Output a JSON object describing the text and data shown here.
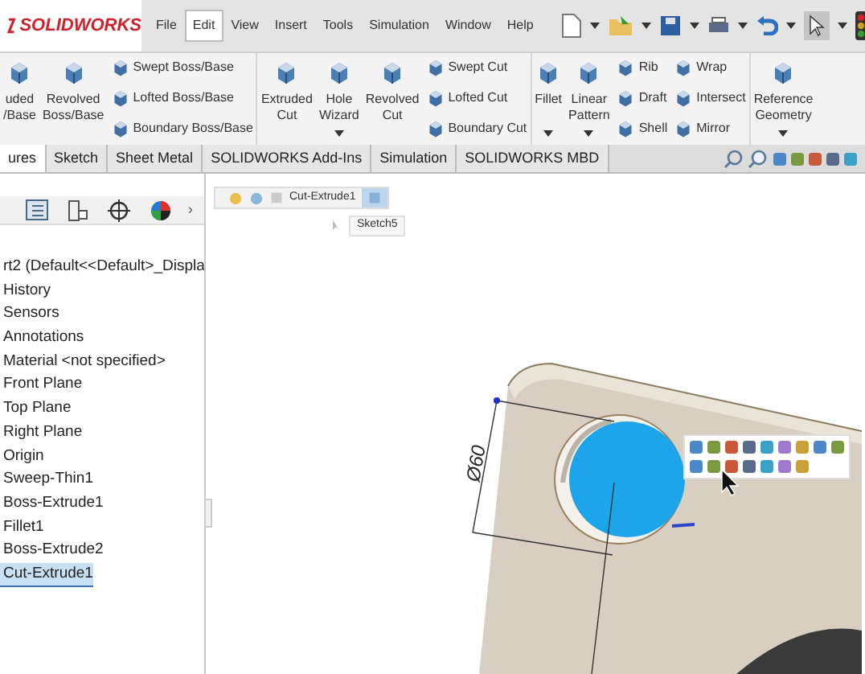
{
  "app": {
    "logo": "SOLIDWORKS"
  },
  "menu": [
    {
      "label": "File",
      "selected": false
    },
    {
      "label": "Edit",
      "selected": true
    },
    {
      "label": "View",
      "selected": false
    },
    {
      "label": "Insert",
      "selected": false
    },
    {
      "label": "Tools",
      "selected": false
    },
    {
      "label": "Simulation",
      "selected": false
    },
    {
      "label": "Window",
      "selected": false
    },
    {
      "label": "Help",
      "selected": false
    }
  ],
  "ribbon": [
    {
      "items": [
        {
          "kind": "large",
          "lines": [
            "uded",
            "/Base"
          ],
          "has_menu": false
        },
        {
          "kind": "large",
          "lines": [
            "Revolved",
            "Boss/Base"
          ],
          "has_menu": false
        },
        {
          "kind": "stack",
          "labels": [
            "Swept Boss/Base",
            "Lofted Boss/Base",
            "Boundary Boss/Base"
          ]
        }
      ]
    },
    {
      "items": [
        {
          "kind": "large",
          "lines": [
            "Extruded",
            "Cut"
          ],
          "has_menu": false
        },
        {
          "kind": "large",
          "lines": [
            "Hole",
            "Wizard"
          ],
          "has_menu": true
        },
        {
          "kind": "large",
          "lines": [
            "Revolved",
            "Cut"
          ],
          "has_menu": false
        },
        {
          "kind": "stack",
          "labels": [
            "Swept Cut",
            "Lofted Cut",
            "Boundary Cut"
          ]
        }
      ]
    },
    {
      "items": [
        {
          "kind": "large",
          "lines": [
            "Fillet"
          ],
          "has_menu": true
        },
        {
          "kind": "large",
          "lines": [
            "Linear",
            "Pattern"
          ],
          "has_menu": true
        },
        {
          "kind": "stack",
          "labels": [
            "Rib",
            "Draft",
            "Shell"
          ]
        },
        {
          "kind": "stack",
          "labels": [
            "Wrap",
            "Intersect",
            "Mirror"
          ]
        }
      ]
    },
    {
      "items": [
        {
          "kind": "large",
          "lines": [
            "Reference",
            "Geometry"
          ],
          "has_menu": true
        }
      ]
    }
  ],
  "tabs": [
    {
      "label": "ures",
      "selected": true
    },
    {
      "label": "Sketch",
      "selected": false
    },
    {
      "label": "Sheet Metal",
      "selected": false
    },
    {
      "label": "SOLIDWORKS Add-Ins",
      "selected": false
    },
    {
      "label": "Simulation",
      "selected": false
    },
    {
      "label": "SOLIDWORKS MBD",
      "selected": false
    }
  ],
  "panel": {
    "more": "›"
  },
  "tree": [
    {
      "label": "rt2  (Default<<Default>_Displa",
      "selected": false
    },
    {
      "label": "History",
      "selected": false
    },
    {
      "label": "Sensors",
      "selected": false
    },
    {
      "label": "Annotations",
      "selected": false
    },
    {
      "label": "Material <not specified>",
      "selected": false
    },
    {
      "label": "Front Plane",
      "selected": false
    },
    {
      "label": "Top Plane",
      "selected": false
    },
    {
      "label": "Right Plane",
      "selected": false
    },
    {
      "label": "Origin",
      "selected": false
    },
    {
      "label": "Sweep-Thin1",
      "selected": false
    },
    {
      "label": "Boss-Extrude1",
      "selected": false
    },
    {
      "label": "Fillet1",
      "selected": false
    },
    {
      "label": "Boss-Extrude2",
      "selected": false
    },
    {
      "label": "Cut-Extrude1",
      "selected": true
    }
  ],
  "breadcrumb": {
    "feature": "Cut-Extrude1",
    "sketch": "Sketch5"
  },
  "dimension": "Ø60"
}
